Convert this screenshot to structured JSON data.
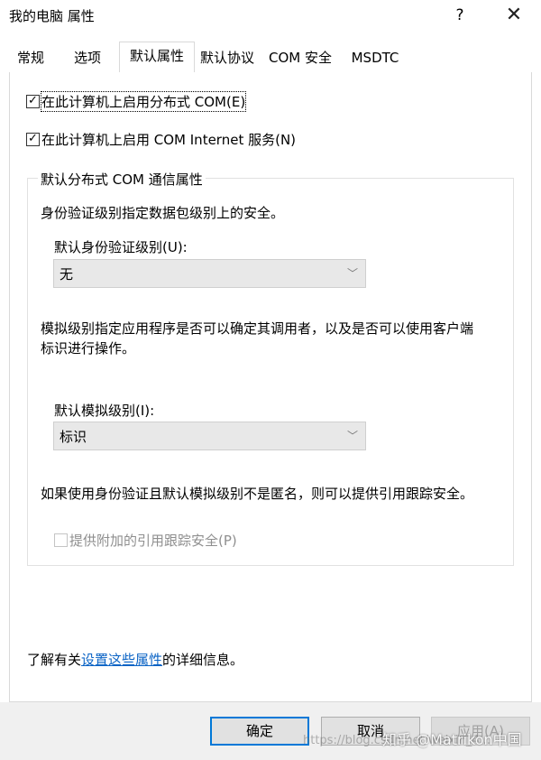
{
  "window": {
    "title": "我的电脑 属性",
    "help": "?",
    "close": "✕"
  },
  "tabs": [
    {
      "label": "常规"
    },
    {
      "label": "选项"
    },
    {
      "label": "默认属性",
      "active": true
    },
    {
      "label": "默认协议"
    },
    {
      "label": "COM 安全"
    },
    {
      "label": "MSDTC"
    }
  ],
  "checks": {
    "enable_dcom": {
      "label": "在此计算机上启用分布式 COM(E)",
      "checked": true
    },
    "enable_com_internet": {
      "label": "在此计算机上启用 COM Internet 服务(N)",
      "checked": true
    }
  },
  "group": {
    "title": "默认分布式 COM 通信属性",
    "auth_desc": "身份验证级别指定数据包级别上的安全。",
    "auth_label": "默认身份验证级别(U):",
    "auth_value": "无",
    "imp_desc_line1": "模拟级别指定应用程序是否可以确定其调用者，以及是否可以使用客户端",
    "imp_desc_line2": "标识进行操作。",
    "imp_label": "默认模拟级别(I):",
    "imp_value": "标识",
    "ref_desc": "如果使用身份验证且默认模拟级别不是匿名，则可以提供引用跟踪安全。",
    "ref_check_label": "提供附加的引用跟踪安全(P)",
    "ref_check_checked": false
  },
  "info": {
    "prefix": "了解有关",
    "link": "设置这些属性",
    "suffix": "的详细信息。"
  },
  "buttons": {
    "ok": "确定",
    "cancel": "取消",
    "apply": "应用(A)"
  },
  "watermarks": {
    "url": "https://blog.csdn.net/weixin_4...",
    "zhihu": "知乎 @Matrikon中国"
  },
  "colors": {
    "link": "#0a63c5",
    "default_button_border": "#0078d7"
  }
}
